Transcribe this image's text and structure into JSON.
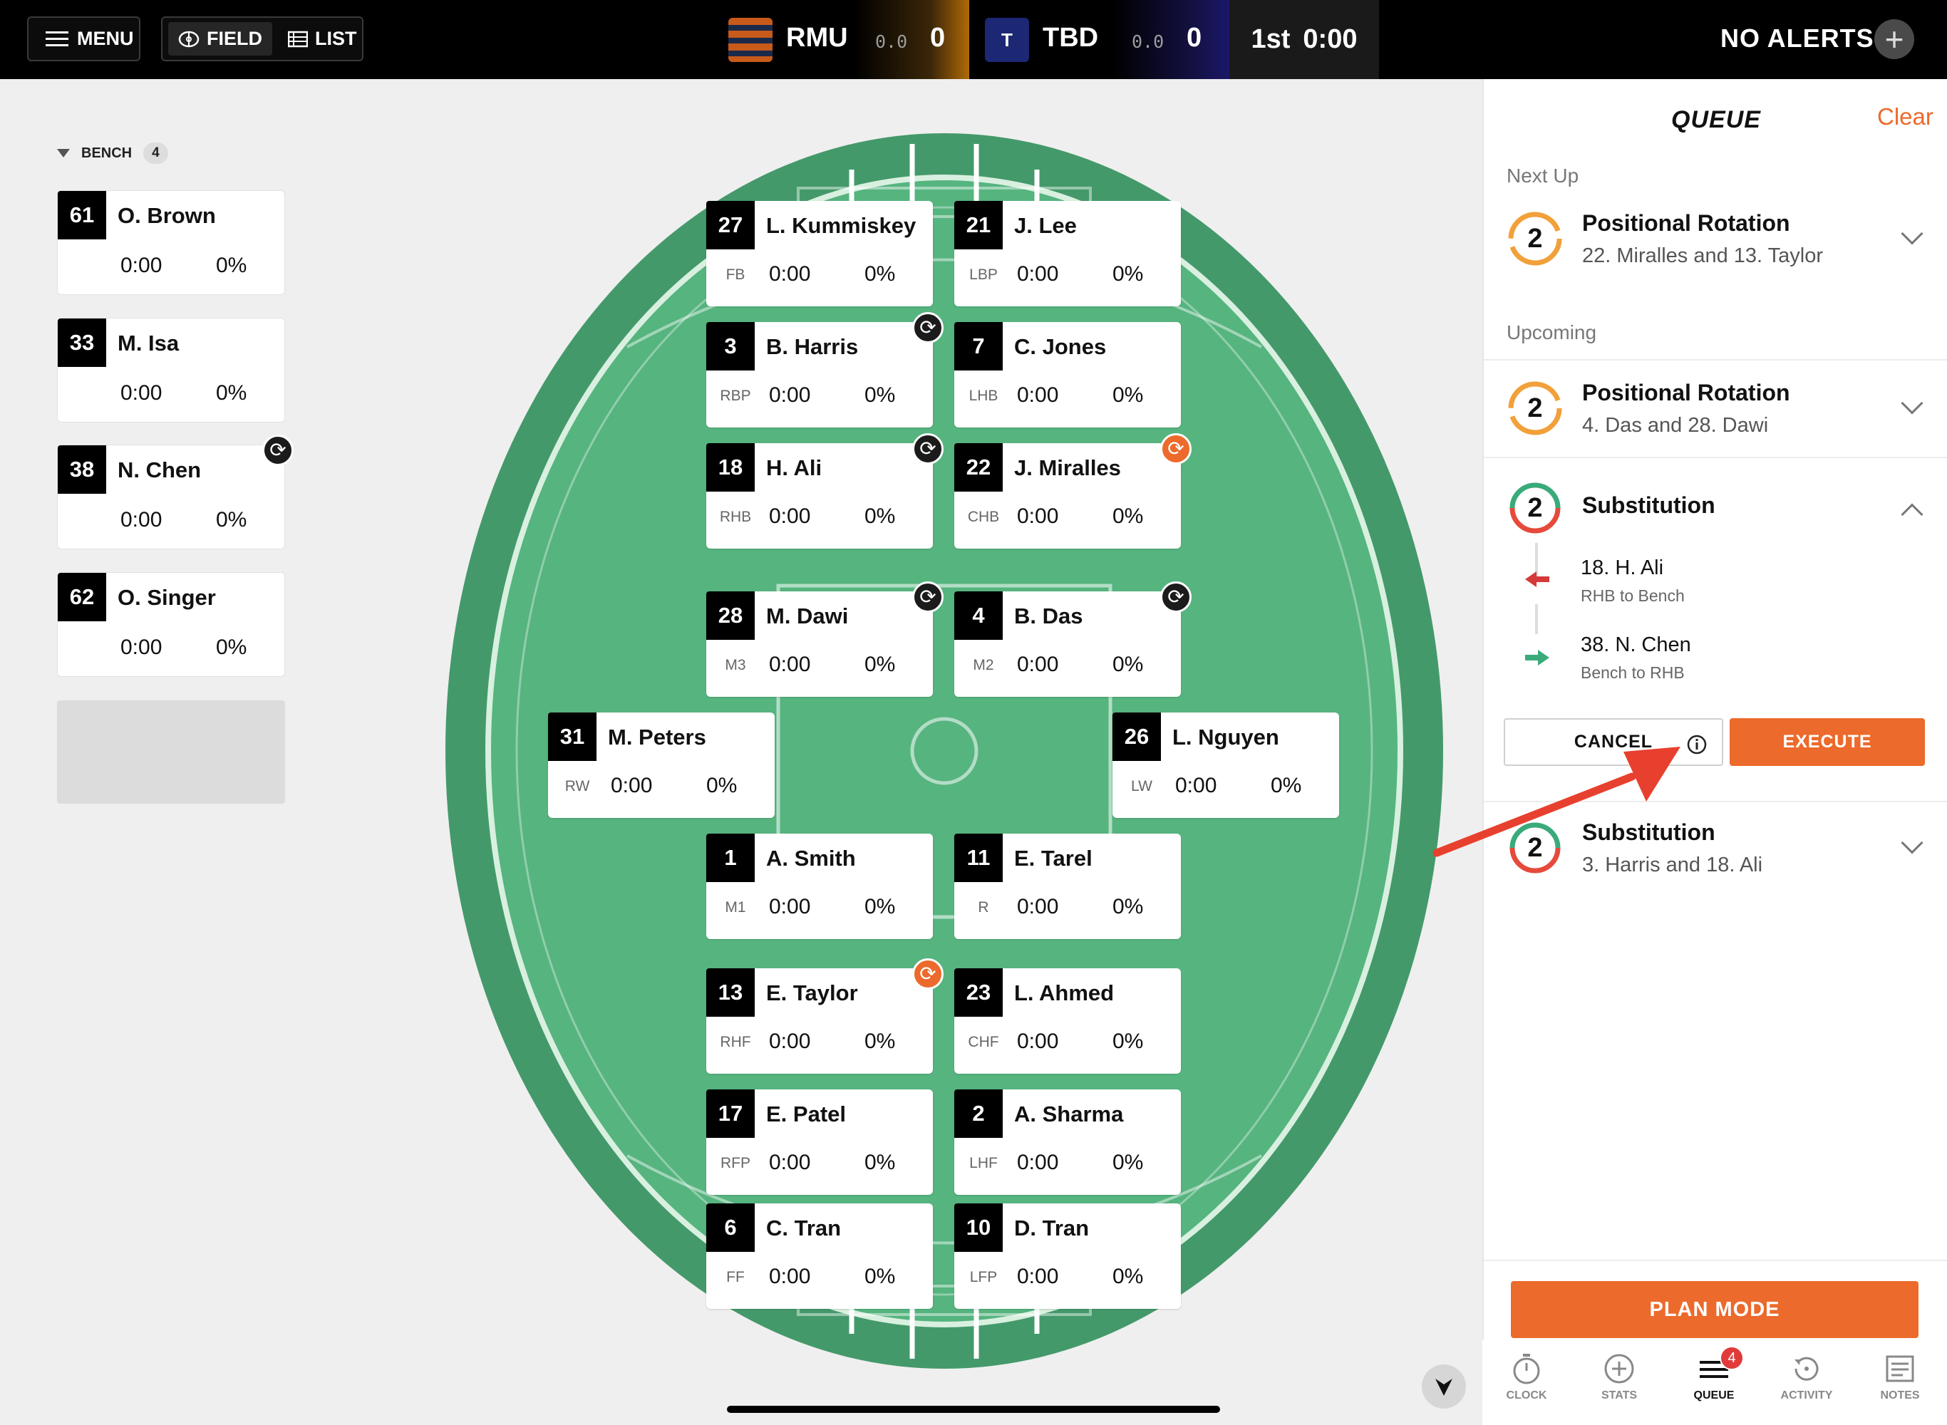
{
  "topbar": {
    "menu_label": "MENU",
    "field_label": "FIELD",
    "list_label": "LIST",
    "home": {
      "name": "RMU",
      "sub": "0.0",
      "score": "0"
    },
    "away": {
      "name": "TBD",
      "logo_letter": "T",
      "sub": "0.0",
      "score": "0"
    },
    "period": "1st",
    "clock": "0:00",
    "alerts": "NO ALERTS"
  },
  "bench": {
    "label": "BENCH",
    "count": "4",
    "players": [
      {
        "num": "61",
        "name": "O. Brown",
        "time": "0:00",
        "pct": "0%"
      },
      {
        "num": "33",
        "name": "M. Isa",
        "time": "0:00",
        "pct": "0%"
      },
      {
        "num": "38",
        "name": "N. Chen",
        "time": "0:00",
        "pct": "0%"
      },
      {
        "num": "62",
        "name": "O. Singer",
        "time": "0:00",
        "pct": "0%"
      }
    ]
  },
  "field": {
    "players": [
      {
        "num": "27",
        "name": "L. Kummiskey",
        "pos": "FB",
        "time": "0:00",
        "pct": "0%"
      },
      {
        "num": "21",
        "name": "J. Lee",
        "pos": "LBP",
        "time": "0:00",
        "pct": "0%"
      },
      {
        "num": "3",
        "name": "B. Harris",
        "pos": "RBP",
        "time": "0:00",
        "pct": "0%"
      },
      {
        "num": "7",
        "name": "C. Jones",
        "pos": "LHB",
        "time": "0:00",
        "pct": "0%"
      },
      {
        "num": "18",
        "name": "H. Ali",
        "pos": "RHB",
        "time": "0:00",
        "pct": "0%"
      },
      {
        "num": "22",
        "name": "J. Miralles",
        "pos": "CHB",
        "time": "0:00",
        "pct": "0%"
      },
      {
        "num": "28",
        "name": "M. Dawi",
        "pos": "M3",
        "time": "0:00",
        "pct": "0%"
      },
      {
        "num": "4",
        "name": "B. Das",
        "pos": "M2",
        "time": "0:00",
        "pct": "0%"
      },
      {
        "num": "31",
        "name": "M. Peters",
        "pos": "RW",
        "time": "0:00",
        "pct": "0%"
      },
      {
        "num": "26",
        "name": "L. Nguyen",
        "pos": "LW",
        "time": "0:00",
        "pct": "0%"
      },
      {
        "num": "1",
        "name": "A. Smith",
        "pos": "M1",
        "time": "0:00",
        "pct": "0%"
      },
      {
        "num": "11",
        "name": "E. Tarel",
        "pos": "R",
        "time": "0:00",
        "pct": "0%"
      },
      {
        "num": "13",
        "name": "E. Taylor",
        "pos": "RHF",
        "time": "0:00",
        "pct": "0%"
      },
      {
        "num": "23",
        "name": "L. Ahmed",
        "pos": "CHF",
        "time": "0:00",
        "pct": "0%"
      },
      {
        "num": "17",
        "name": "E. Patel",
        "pos": "RFP",
        "time": "0:00",
        "pct": "0%"
      },
      {
        "num": "2",
        "name": "A. Sharma",
        "pos": "LHF",
        "time": "0:00",
        "pct": "0%"
      },
      {
        "num": "6",
        "name": "C. Tran",
        "pos": "FF",
        "time": "0:00",
        "pct": "0%"
      },
      {
        "num": "10",
        "name": "D. Tran",
        "pos": "LFP",
        "time": "0:00",
        "pct": "0%"
      }
    ]
  },
  "queue": {
    "title": "QUEUE",
    "clear": "Clear",
    "next_up_label": "Next Up",
    "upcoming_label": "Upcoming",
    "items": [
      {
        "count": "2",
        "title": "Positional Rotation",
        "sub": "22. Miralles and 13. Taylor"
      },
      {
        "count": "2",
        "title": "Positional Rotation",
        "sub": "4. Das and 28. Dawi"
      },
      {
        "count": "2",
        "title": "Substitution",
        "out": {
          "name": "18. H. Ali",
          "detail": "RHB to Bench"
        },
        "in": {
          "name": "38. N. Chen",
          "detail": "Bench to RHB"
        },
        "cancel": "CANCEL",
        "execute": "EXECUTE"
      },
      {
        "count": "2",
        "title": "Substitution",
        "sub": "3. Harris and 18. Ali"
      }
    ],
    "plan_mode": "PLAN MODE"
  },
  "tabs": {
    "clock": "CLOCK",
    "stats": "STATS",
    "queue": "QUEUE",
    "queue_badge": "4",
    "activity": "ACTIVITY",
    "notes": "NOTES"
  },
  "colors": {
    "accent": "#ec6a2b",
    "field_outer": "#44996a",
    "field_inner": "#56b47f",
    "out_arrow": "#d43a3a",
    "in_arrow": "#3aaa7a"
  }
}
